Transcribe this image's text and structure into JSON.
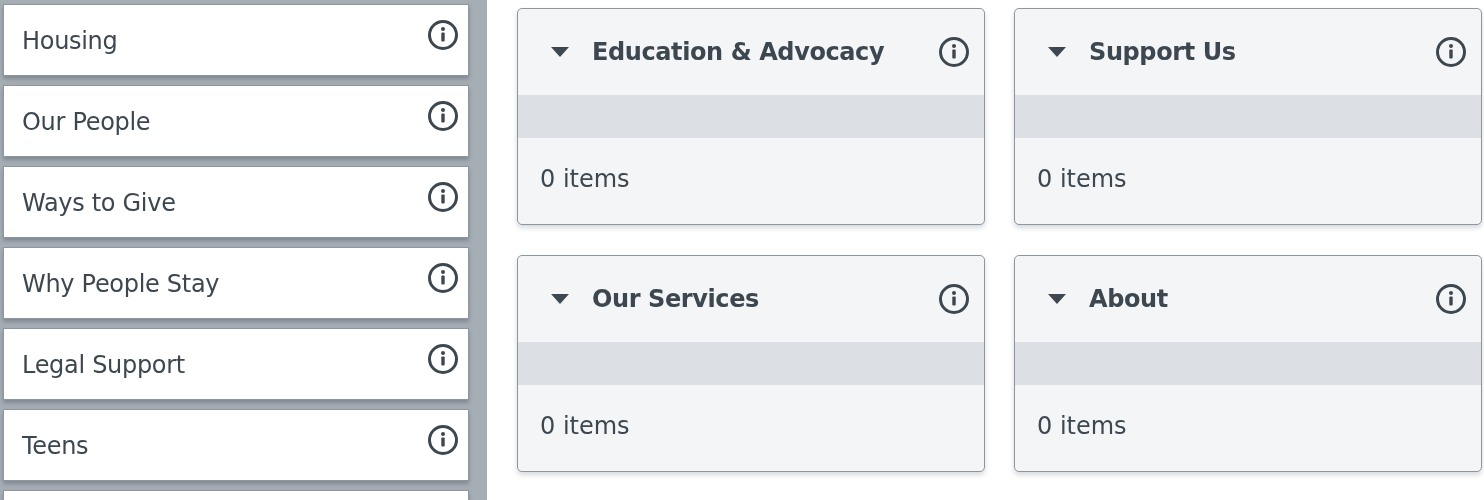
{
  "sidebar": {
    "items": [
      {
        "label": "Housing"
      },
      {
        "label": "Our People"
      },
      {
        "label": "Ways to Give"
      },
      {
        "label": "Why People Stay"
      },
      {
        "label": "Legal Support"
      },
      {
        "label": "Teens"
      }
    ]
  },
  "cards": [
    {
      "title": "Education & Advocacy",
      "expanded": true,
      "count": "0 items"
    },
    {
      "title": "Support Us",
      "expanded": true,
      "count": "0 items"
    },
    {
      "title": "Our Services",
      "expanded": true,
      "count": "0 items"
    },
    {
      "title": "About",
      "expanded": true,
      "count": "0 items"
    }
  ]
}
